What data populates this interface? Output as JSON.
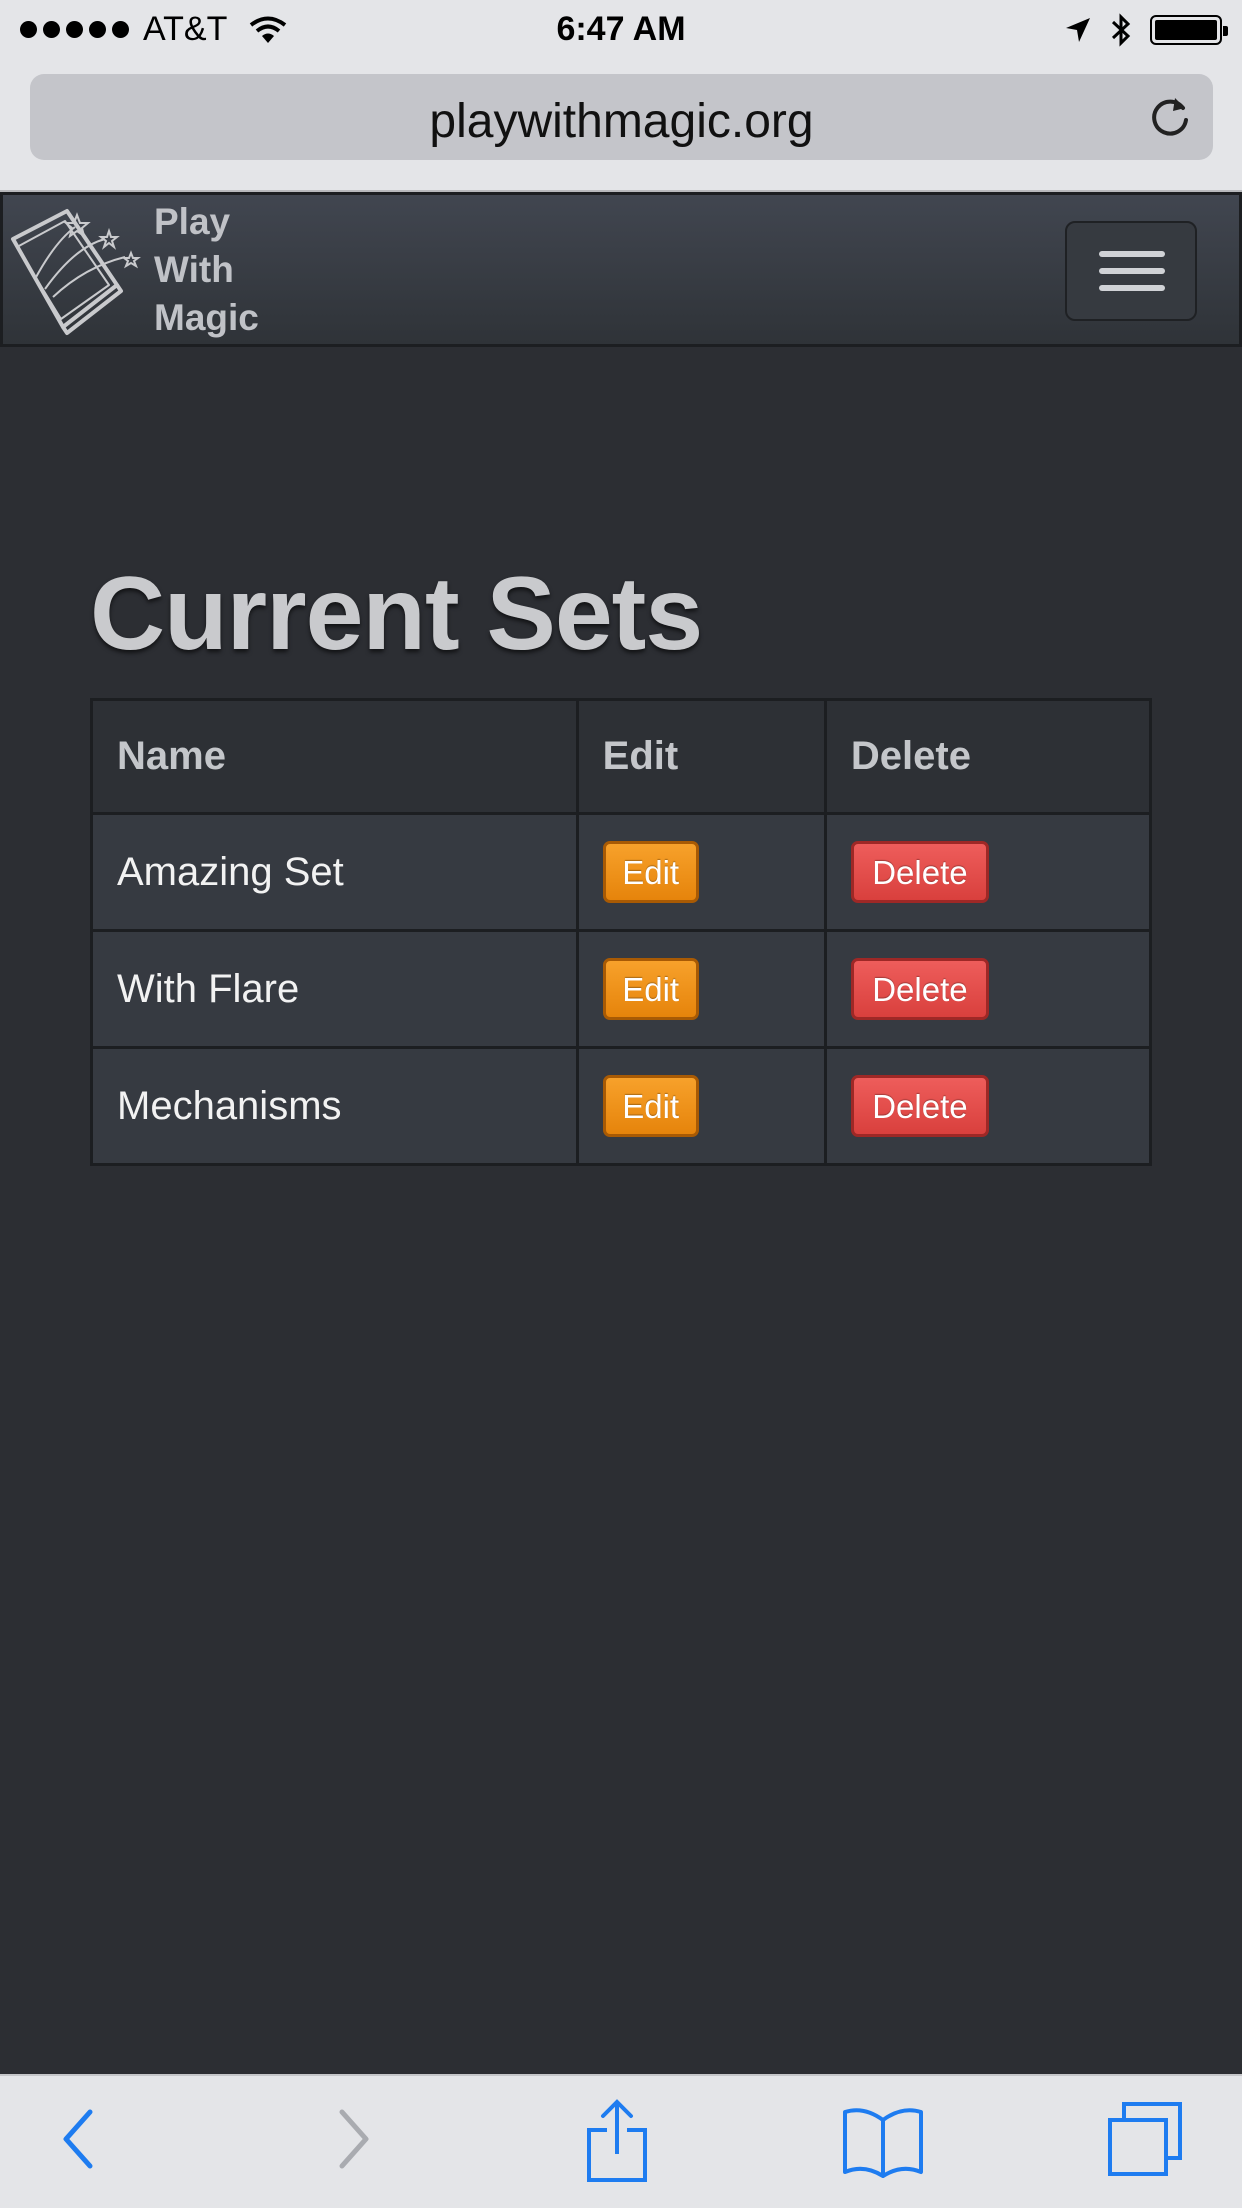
{
  "status_bar": {
    "carrier": "AT&T",
    "time": "6:47 AM"
  },
  "browser": {
    "url": "playwithmagic.org"
  },
  "navbar": {
    "brand_lines": [
      "Play",
      "With",
      "Magic"
    ]
  },
  "main": {
    "title": "Current Sets",
    "table": {
      "headers": [
        "Name",
        "Edit",
        "Delete"
      ],
      "rows": [
        {
          "name": "Amazing Set",
          "edit_label": "Edit",
          "delete_label": "Delete"
        },
        {
          "name": "With Flare",
          "edit_label": "Edit",
          "delete_label": "Delete"
        },
        {
          "name": "Mechanisms",
          "edit_label": "Edit",
          "delete_label": "Delete"
        }
      ]
    }
  },
  "colors": {
    "page_background": "#2c2e33",
    "edit_button": "#ee8f14",
    "delete_button": "#e24c4a",
    "ios_tint": "#1e7cf0"
  },
  "icons": {
    "status": [
      "signal-dots-icon",
      "wifi-icon",
      "location-arrow-icon",
      "bluetooth-icon",
      "battery-icon"
    ],
    "url_bar": [
      "reload-icon"
    ],
    "navbar": [
      "magic-book-logo",
      "hamburger-menu-icon"
    ],
    "toolbar": [
      "back-chevron-icon",
      "forward-chevron-icon",
      "share-icon",
      "bookmarks-icon",
      "tabs-icon"
    ]
  }
}
